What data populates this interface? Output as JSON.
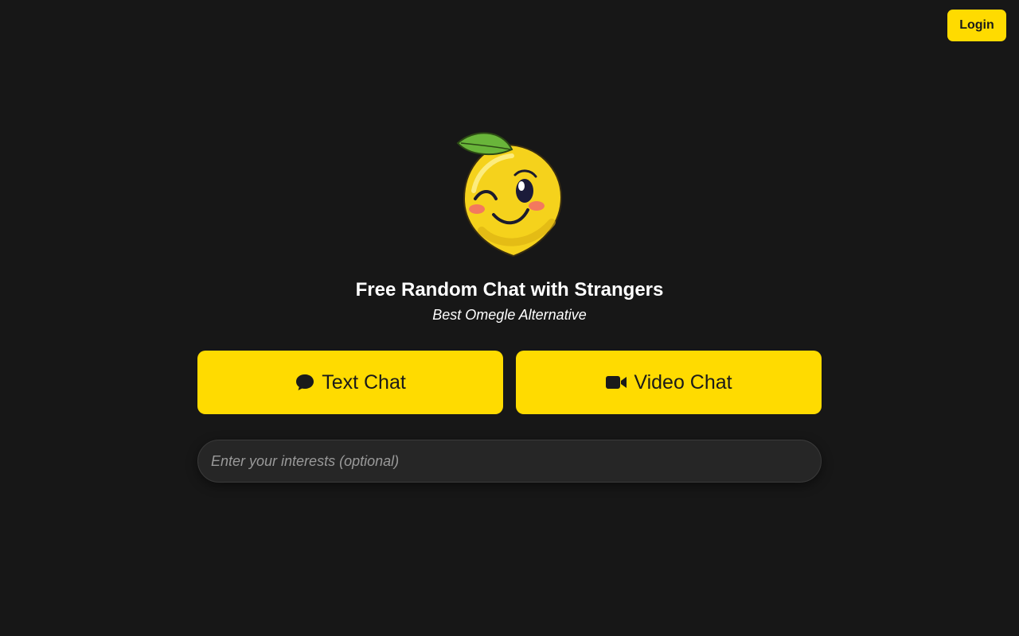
{
  "header": {
    "login_label": "Login"
  },
  "hero": {
    "mascot": "winking-lemon-mascot",
    "title": "Free Random Chat with Strangers",
    "subtitle": "Best Omegle Alternative"
  },
  "actions": {
    "text_chat": {
      "icon": "speech-bubble-icon",
      "label": "Text Chat"
    },
    "video_chat": {
      "icon": "video-camera-icon",
      "label": "Video Chat"
    }
  },
  "interests": {
    "placeholder": "Enter your interests (optional)",
    "value": ""
  },
  "colors": {
    "background": "#171717",
    "accent": "#ffdb00",
    "input_background": "#262626"
  }
}
